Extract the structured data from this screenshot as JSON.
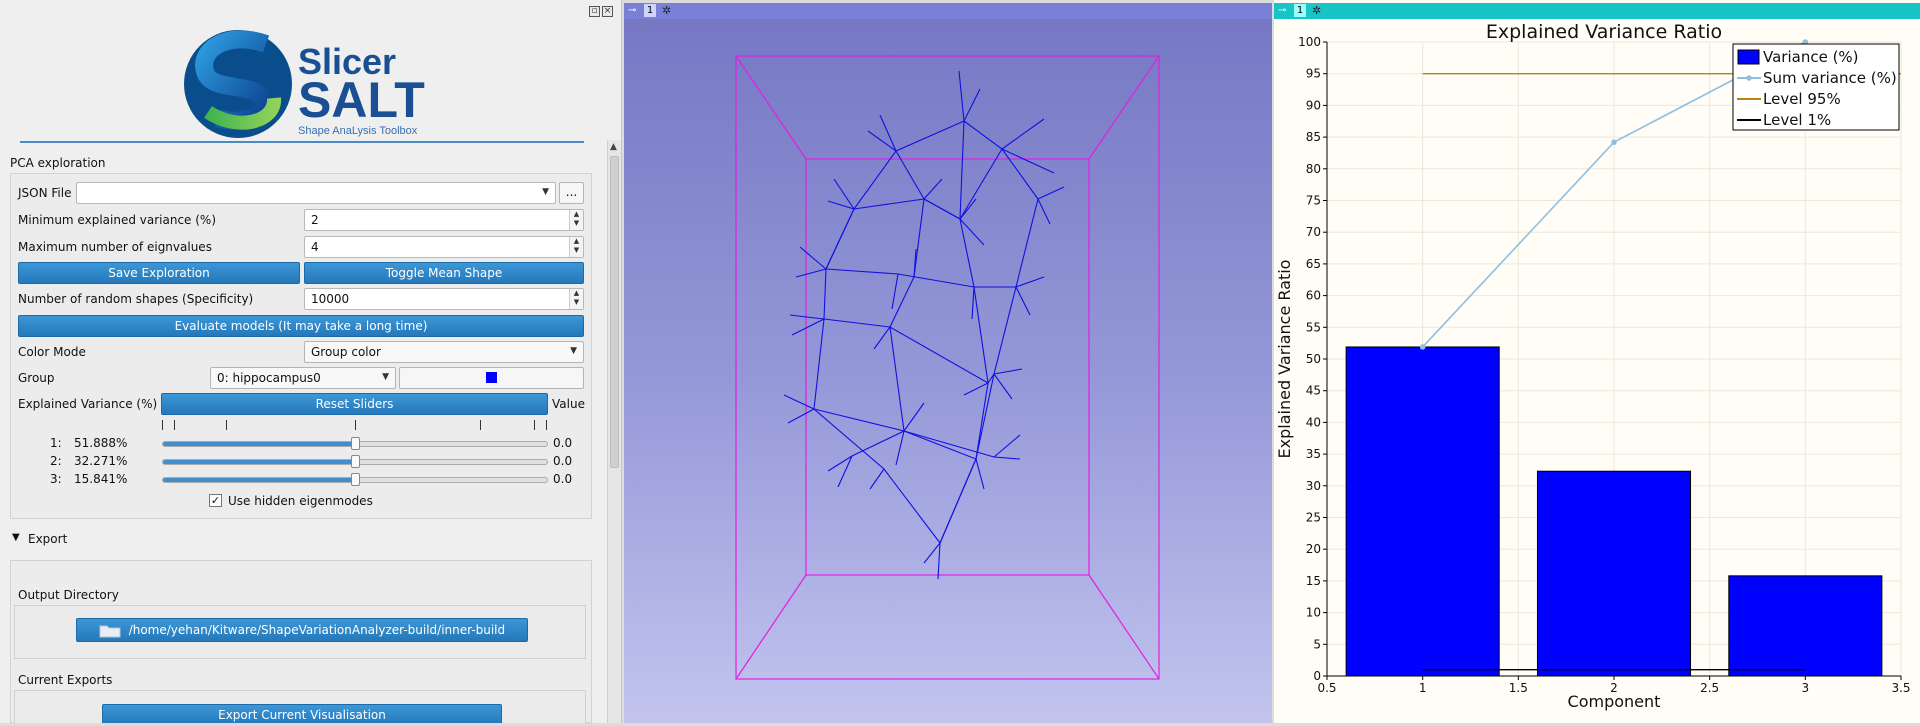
{
  "logo": {
    "line1": "Slicer",
    "line2": "SALT",
    "tagline": "Shape AnaLysis Toolbox"
  },
  "pca": {
    "section_title": "PCA exploration",
    "json_file_label": "JSON File",
    "json_file_value": "",
    "browse_label": "...",
    "min_variance_label": "Minimum explained variance (%)",
    "min_variance_value": "2",
    "max_eigen_label": "Maximum number of eignvalues",
    "max_eigen_value": "4",
    "save_exploration": "Save Exploration",
    "toggle_mean_shape": "Toggle Mean Shape",
    "random_shapes_label": "Number of random shapes (Specificity)",
    "random_shapes_value": "10000",
    "evaluate_models": "Evaluate models (It may take a long time)",
    "color_mode_label": "Color Mode",
    "color_mode_value": "Group color",
    "group_label": "Group",
    "group_value": "0: hippocampus0",
    "group_color": "#0000ff",
    "explained_variance_label": "Explained Variance (%)",
    "reset_sliders": "Reset Sliders",
    "value_header": "Value",
    "sliders": [
      {
        "index": "1:",
        "percent": "51.888%",
        "value": "0.0",
        "level": 0.5
      },
      {
        "index": "2:",
        "percent": "32.271%",
        "value": "0.0",
        "level": 0.5
      },
      {
        "index": "3:",
        "percent": "15.841%",
        "value": "0.0",
        "level": 0.5
      }
    ],
    "use_hidden_label": "Use hidden eigenmodes",
    "use_hidden_checked": true
  },
  "export": {
    "section_title": "Export",
    "output_directory_label": "Output Directory",
    "output_directory_value": "/home/yehan/Kitware/ShapeVariationAnalyzer-build/inner-build",
    "current_exports_label": "Current Exports",
    "export_button": "Export Current Visualisation"
  },
  "view3d": {
    "view_number": "1",
    "background_top": "#7678c4",
    "box_color": "#e020e0",
    "mesh_color": "#1010e0"
  },
  "chartview": {
    "view_number": "1"
  },
  "chart_data": {
    "type": "bar",
    "title": "Explained Variance Ratio",
    "xlabel": "Component",
    "ylabel": "Explained Variance Ratio",
    "xlim": [
      0.5,
      3.5
    ],
    "ylim": [
      0,
      100
    ],
    "xticks": [
      "0.5",
      "1",
      "1.5",
      "2",
      "2.5",
      "3",
      "3.5"
    ],
    "yticks": [
      "0",
      "5",
      "10",
      "15",
      "20",
      "25",
      "30",
      "35",
      "40",
      "45",
      "50",
      "55",
      "60",
      "65",
      "70",
      "75",
      "80",
      "85",
      "90",
      "95",
      "100"
    ],
    "grid": true,
    "legend_position": "top-right",
    "series": [
      {
        "name": "Variance (%)",
        "type": "bar",
        "color": "#0000ff",
        "x": [
          1,
          2,
          3
        ],
        "values": [
          51.9,
          32.3,
          15.8
        ]
      },
      {
        "name": "Sum variance (%)",
        "type": "line",
        "color": "#8fbfe0",
        "x": [
          1,
          2,
          3
        ],
        "values": [
          51.9,
          84.2,
          100
        ]
      },
      {
        "name": "Level 95%",
        "type": "line",
        "color": "#b8860b",
        "x": [
          1,
          3.5
        ],
        "values": [
          95,
          95
        ]
      },
      {
        "name": "Level 1%",
        "type": "line",
        "color": "#000000",
        "x": [
          1,
          3
        ],
        "values": [
          1,
          1
        ]
      }
    ]
  }
}
